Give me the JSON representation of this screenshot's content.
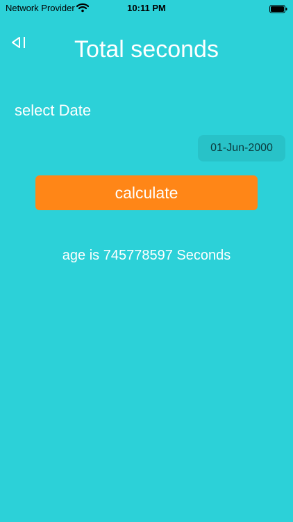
{
  "status_bar": {
    "carrier": "Network Provider",
    "time": "10:11 PM",
    "wifi_icon": "wifi-icon",
    "battery_icon": "battery-icon"
  },
  "nav": {
    "back_icon": "back-icon",
    "title": "Total seconds"
  },
  "form": {
    "select_label": "select Date",
    "selected_date": "01-Jun-2000",
    "calculate_label": "calculate"
  },
  "result": {
    "text": "age is 745778597 Seconds"
  },
  "colors": {
    "background": "#2CD1D8",
    "button": "#FF8617",
    "text": "#FFFFFF"
  }
}
